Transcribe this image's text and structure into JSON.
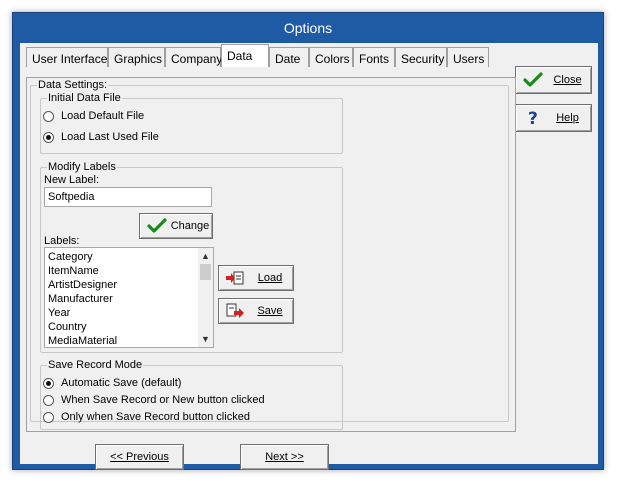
{
  "window": {
    "title": "Options"
  },
  "tabs": [
    {
      "label": "User Interface"
    },
    {
      "label": "Graphics"
    },
    {
      "label": "Company"
    },
    {
      "label": "Data"
    },
    {
      "label": "Date"
    },
    {
      "label": "Colors"
    },
    {
      "label": "Fonts"
    },
    {
      "label": "Security"
    },
    {
      "label": "Users"
    }
  ],
  "active_tab": "Data",
  "data_settings": {
    "title": "Data Settings:",
    "initial_file": {
      "title": "Initial Data File",
      "options": [
        {
          "label": "Load Default File",
          "selected": false
        },
        {
          "label": "Load Last Used File",
          "selected": true
        }
      ]
    },
    "modify_labels": {
      "title": "Modify Labels",
      "new_label_caption": "New Label:",
      "new_label_value": "Softpedia",
      "change_button": "Change",
      "labels_caption": "Labels:",
      "labels": [
        "Category",
        "ItemName",
        "ArtistDesigner",
        "Manufacturer",
        "Year",
        "Country",
        "MediaMaterial"
      ],
      "load_button": "Load",
      "save_button": "Save"
    },
    "save_record_mode": {
      "title": "Save Record Mode",
      "options": [
        {
          "label": "Automatic Save (default)",
          "selected": true
        },
        {
          "label": "When Save Record or New button clicked",
          "selected": false
        },
        {
          "label": "Only when Save Record button clicked",
          "selected": false
        }
      ]
    }
  },
  "side_buttons": {
    "close": "Close",
    "help": "Help"
  },
  "nav_buttons": {
    "previous": "<< Previous",
    "next": "Next >>"
  },
  "colors": {
    "window_frame": "#1f5ba4",
    "dialog_bg": "#f0f0f0",
    "check_green": "#1a8a1a"
  }
}
